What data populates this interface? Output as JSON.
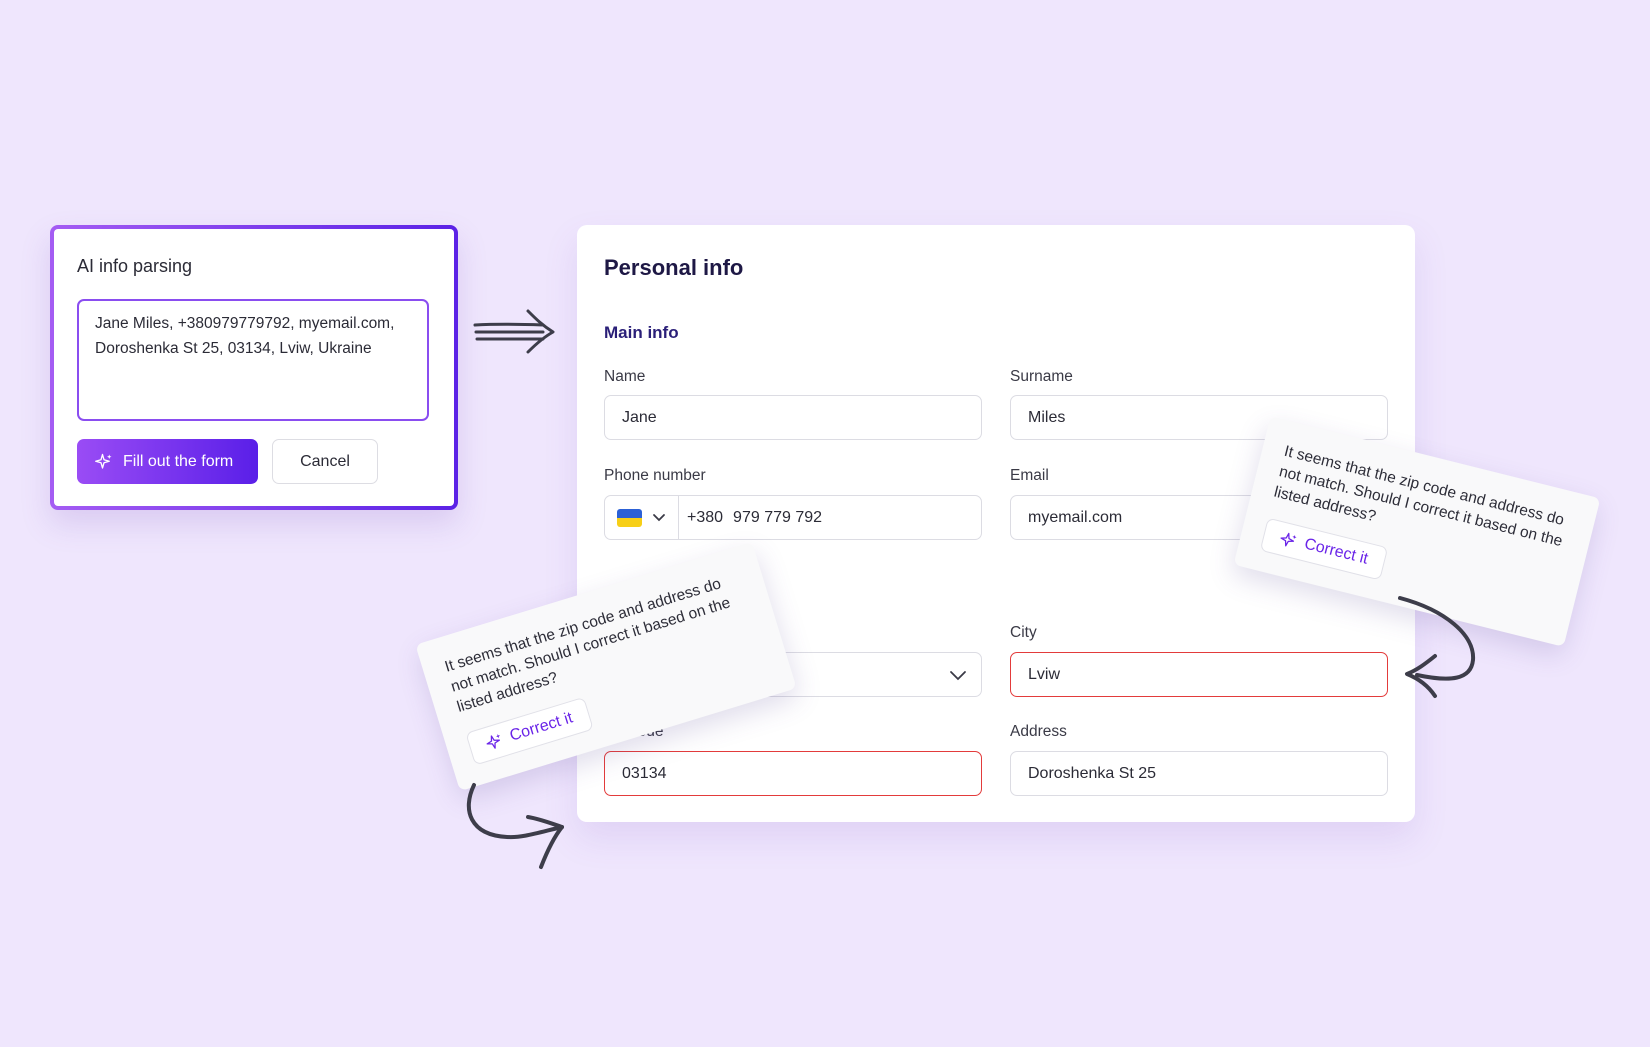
{
  "ai_card": {
    "title": "AI info parsing",
    "input_value": "Jane Miles, +380979779792, myemail.com, Doroshenka St 25, 03134, Lviw, Ukraine",
    "fill_button": "Fill out the form",
    "cancel_button": "Cancel"
  },
  "form": {
    "title": "Personal info",
    "section": "Main info",
    "name": {
      "label": "Name",
      "value": "Jane"
    },
    "surname": {
      "label": "Surname",
      "value": "Miles"
    },
    "phone": {
      "label": "Phone number",
      "code": "+380",
      "value": "979 779 792"
    },
    "email": {
      "label": "Email",
      "value": "myemail.com"
    },
    "city": {
      "label": "City",
      "value": "Lviw"
    },
    "zip": {
      "label": "Zip code",
      "value": "03134"
    },
    "address": {
      "label": "Address",
      "value": "Doroshenka St 25"
    }
  },
  "hints": [
    {
      "text": "It seems that the zip code and address do not match. Should I correct it based on the listed address?",
      "button": "Correct it"
    },
    {
      "text": "It seems that the zip code and address do not match. Should I correct it based on the listed address?",
      "button": "Correct it"
    }
  ],
  "colors": {
    "background": "#efe6fd",
    "accent": "#6a24e8",
    "error": "#e33b3b",
    "flag_blue": "#2c61d6",
    "flag_yellow": "#f7cf17"
  },
  "icons": [
    "sparkle-icon",
    "chevron-down-icon",
    "ukraine-flag-icon",
    "arrow-icon"
  ]
}
